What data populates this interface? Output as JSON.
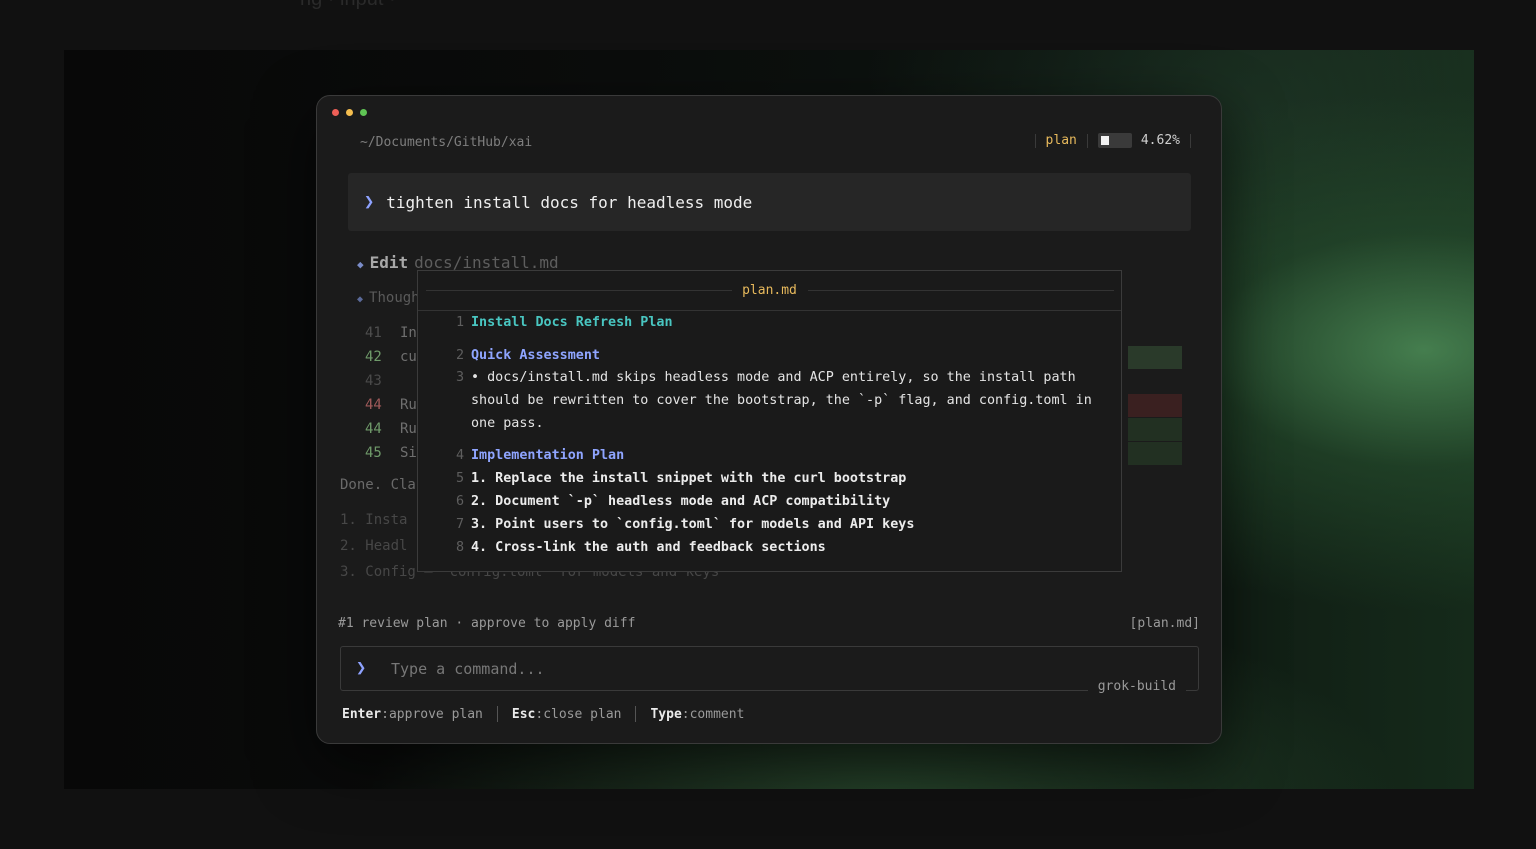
{
  "caption": "ng · input ·",
  "window": {
    "path": "~/Documents/GitHub/xai",
    "mode": "plan",
    "usage": "4.62%",
    "usage_fraction": 0.0462
  },
  "prompt": {
    "text": "tighten install docs for headless mode"
  },
  "background": {
    "edit_keyword": "Edit",
    "edit_file": "docs/install.md",
    "thought": "Thought",
    "diff": [
      {
        "num": "41",
        "text": "In"
      },
      {
        "num": "42",
        "text": "cu"
      },
      {
        "num": "43",
        "text": ""
      },
      {
        "num": "44",
        "text": "Ru"
      },
      {
        "num": "44",
        "text": "Ru"
      },
      {
        "num": "45",
        "text": "Si"
      }
    ],
    "done": "Done. Cla",
    "summary": [
      "1. Insta",
      "2. Headl",
      "3. Config — `config.toml` for models and keys"
    ]
  },
  "plan_overlay": {
    "title": "plan.md",
    "lines": [
      {
        "num": "1",
        "text": "Install Docs Refresh Plan"
      },
      {
        "num": "2",
        "text": "Quick Assessment"
      },
      {
        "num": "3",
        "text": "• docs/install.md skips headless mode and ACP entirely, so the install path should be rewritten to cover the bootstrap, the `-p` flag, and config.toml in one pass."
      },
      {
        "num": "4",
        "text": "Implementation Plan"
      },
      {
        "num": "5",
        "text": "1. Replace the install snippet with the curl bootstrap"
      },
      {
        "num": "6",
        "text": "2. Document `-p` headless mode and ACP compatibility"
      },
      {
        "num": "7",
        "text": "3. Point users to `config.toml` for models and API keys"
      },
      {
        "num": "8",
        "text": "4. Cross-link the auth and feedback sections"
      }
    ]
  },
  "footer": {
    "left": "#1 review plan · approve to apply diff",
    "right": "[plan.md]"
  },
  "command": {
    "placeholder": "Type a command...",
    "agent": "grok-build"
  },
  "hints": [
    {
      "key": "Enter",
      "desc": ":approve plan"
    },
    {
      "key": "Esc",
      "desc": ":close plan"
    },
    {
      "key": "Type",
      "desc": ":comment"
    }
  ],
  "colors": {
    "accent_yellow": "#e7b95c",
    "accent_blue": "#8fa5ff",
    "accent_teal": "#49c6c1"
  },
  "icons": {
    "prompt": "chevron-right-icon",
    "bullet": "diamond-icon"
  }
}
